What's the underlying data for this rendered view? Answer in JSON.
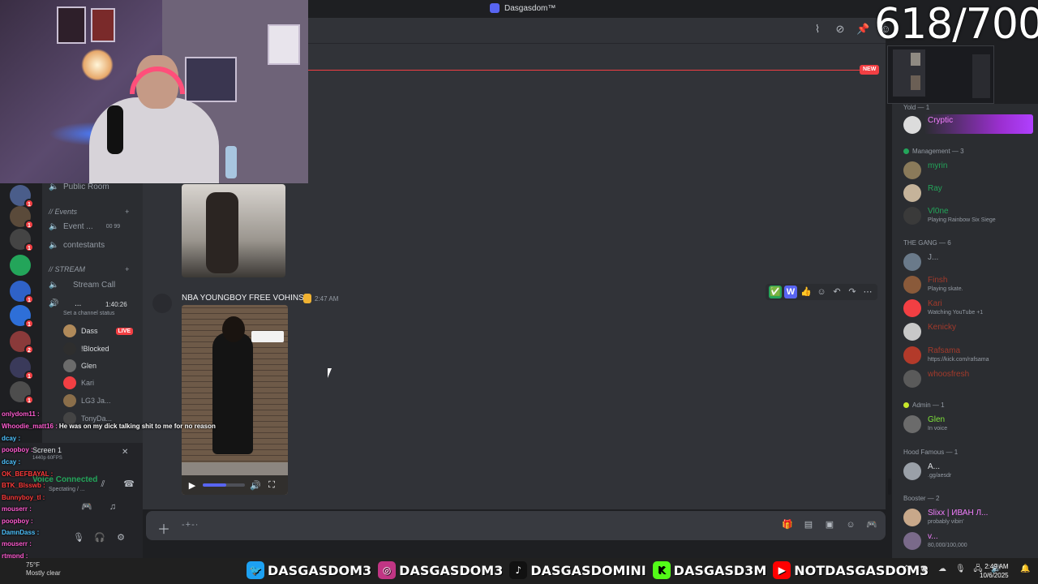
{
  "window": {
    "title": "Dasgasdom™"
  },
  "overlay": {
    "counter": "618/700"
  },
  "channels": {
    "public_room": "Public Room",
    "events_category": "// Events",
    "event_channel": "Event ...",
    "event_counts": "00  99",
    "contestants": "contestants",
    "stream_category": "// STREAM",
    "stream_call": "Stream Call",
    "active_channel": "...",
    "active_timer": "1:40:26",
    "set_status": "Set a channel status",
    "voice_users": [
      {
        "name": "Dass",
        "live": "LIVE"
      },
      {
        "name": "!Blocked"
      },
      {
        "name": "Glen"
      },
      {
        "name": "Kari"
      },
      {
        "name": "LG3 Ja..."
      },
      {
        "name": "TonyDa..."
      }
    ]
  },
  "servers": [
    {
      "ping": "1"
    },
    {
      "ping": "1"
    },
    {
      "ping": "1"
    },
    {
      "ping": ""
    },
    {
      "ping": "1"
    },
    {
      "ping": "1"
    },
    {
      "ping": "2"
    },
    {
      "ping": "1"
    },
    {
      "ping": "1"
    }
  ],
  "user_panel": {
    "screen_label": "Screen 1",
    "screen_sub": "1440p 60FPS",
    "voice_connected": "Voice Connected",
    "voice_sub": "Spectating / ..."
  },
  "message": {
    "author": "NBA YOUNGBOY FREE VOHINS",
    "time": "2:47 AM",
    "video_progress_fraction": 0.55
  },
  "hover_actions": [
    "✅",
    "W",
    "👍",
    "☺",
    "↶",
    "↷",
    "⋯"
  ],
  "new_badge": "NEW",
  "members": {
    "top_group": "Yold — 1",
    "top_member": "Cryptic",
    "groups": [
      {
        "label": "Management — 3",
        "color": "#23a55a",
        "members": [
          {
            "name": "myrin",
            "color": "#23a55a",
            "status": ""
          },
          {
            "name": "Ray",
            "color": "#23a55a",
            "status": ""
          },
          {
            "name": "Vl0ne",
            "color": "#23a55a",
            "status": "Playing Rainbow Six Siege"
          }
        ]
      },
      {
        "label": "THE GANG — 6",
        "color": "#80848e",
        "members": [
          {
            "name": "J...",
            "color": "#949ba4",
            "status": ""
          },
          {
            "name": "Finsh",
            "color": "#a33a2b",
            "status": "Playing skate."
          },
          {
            "name": "Kari",
            "color": "#a33a2b",
            "status": "Watching YouTube +1"
          },
          {
            "name": "Kenicky",
            "color": "#a33a2b",
            "status": ""
          },
          {
            "name": "Rafsama",
            "color": "#a33a2b",
            "status": "https://kick.com/rafsama"
          },
          {
            "name": "whoosfresh",
            "color": "#a33a2b",
            "status": ""
          }
        ]
      },
      {
        "label": "Admin — 1",
        "color": "#c8e82b",
        "members": [
          {
            "name": "Glen",
            "color": "#7ee33a",
            "status": "In voice"
          }
        ]
      },
      {
        "label": "Hood Famous — 1",
        "color": "#80848e",
        "members": [
          {
            "name": "A...",
            "color": "#dbdee1",
            "status": ".gg/aesdr"
          }
        ]
      },
      {
        "label": "Booster — 2",
        "color": "#f47fff",
        "members": [
          {
            "name": "Slixx | ИВАН Л...",
            "color": "#f47fff",
            "status": "probably vibin'"
          },
          {
            "name": "v...",
            "color": "#f47fff",
            "status": "80,000/100,000"
          }
        ]
      }
    ]
  },
  "stream_chat": [
    {
      "user": "onlydom11 :",
      "color": "#ff5cd1",
      "text": ""
    },
    {
      "user": "Whoodie_matt16 :",
      "color": "#ff5cd1",
      "text": "He was on my dick talking shit to me for no reason"
    },
    {
      "user": "dcay :",
      "color": "#4fc3ff",
      "text": ""
    },
    {
      "user": "poopboy :",
      "color": "#ff5cd1",
      "text": ""
    },
    {
      "user": "dcay :",
      "color": "#4fc3ff",
      "text": ""
    },
    {
      "user": "OK_BEFBAYAL :",
      "color": "#ff3b3b",
      "text": ""
    },
    {
      "user": "BTK_Blsswb :",
      "color": "#ff3b3b",
      "text": ""
    },
    {
      "user": "Bunnyboy_tl :",
      "color": "#ff3b3b",
      "text": ""
    },
    {
      "user": "mouserr :",
      "color": "#ff5cd1",
      "text": ""
    },
    {
      "user": "poopboy :",
      "color": "#ff5cd1",
      "text": ""
    },
    {
      "user": "DamnDass :",
      "color": "#4fc3ff",
      "text": ""
    },
    {
      "user": "mouserr :",
      "color": "#ff5cd1",
      "text": ""
    },
    {
      "user": "rtmpnd :",
      "color": "#ff5cd1",
      "text": ""
    }
  ],
  "taskbar": {
    "weather_temp": "75°F",
    "weather_desc": "Mostly clear",
    "socials": [
      {
        "icon": "twitter-icon",
        "glyph": "🐦",
        "bg": "#1da1f2",
        "handle": "DASGASDOM3"
      },
      {
        "icon": "instagram-icon",
        "glyph": "◎",
        "bg": "#c13584",
        "handle": "DASGASDOM3"
      },
      {
        "icon": "tiktok-icon",
        "glyph": "♪",
        "bg": "#111111",
        "handle": "DASGASDOMINI"
      },
      {
        "icon": "kick-icon",
        "glyph": "K",
        "bg": "#53fc18",
        "handle": "DASGASD3M"
      },
      {
        "icon": "youtube-icon",
        "glyph": "▶",
        "bg": "#ff0000",
        "handle": "NOTDASGASDOM3"
      }
    ],
    "time": "2:49 AM",
    "date": "10/6/2025"
  }
}
